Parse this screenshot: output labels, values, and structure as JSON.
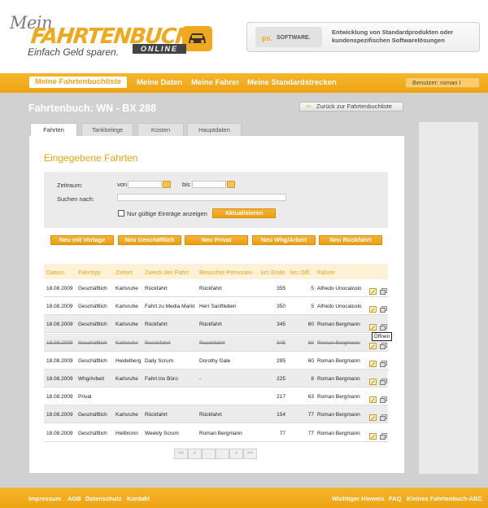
{
  "brand": {
    "mein": "Mein",
    "name": "FAHRTENBUCH",
    "online": "ONLINE",
    "slogan": "Einfach Geld sparen.",
    "accent": "#eea413"
  },
  "partner": {
    "logo_mark": "ps.",
    "logo_text": "SOFTWARE.",
    "text": "Entwicklung von Standardprodukten oder kundenspezifischen Softwarelösungen"
  },
  "nav": {
    "items": [
      "Meine Fahrtenbuchliste",
      "Meine Daten",
      "Meine Fahrer",
      "Meine Standardstrecken"
    ],
    "user": "Benutzer:  roman I"
  },
  "page": {
    "title": "Fahrtenbuch: WN - BX 288",
    "back_label": "Zurück zur Fahrtenbuchliste"
  },
  "tabs": [
    "Fahrten",
    "Tankbelege",
    "Kosten",
    "Hauptdaten"
  ],
  "section_title": "Eingegebene Fahrten",
  "filter": {
    "zeitraum_label": "Zeitraum:",
    "von_label": "von",
    "bis_label": "bis",
    "von_value": "",
    "bis_value": "",
    "suchen_label": "Suchen nach:",
    "suchen_value": "",
    "checkbox_label": "Nur gültige Einträge anzeigen",
    "update_button": "Aktualisieren"
  },
  "actions": [
    "Neu mit Vorlage",
    "Neu Geschäftlich",
    "Neu Privat",
    "Neu Whg/Arbeit",
    "Neu Rückfahrt"
  ],
  "table": {
    "headers": [
      "Datum",
      "Fahrttyp",
      "Zielort",
      "Zweck der Fahrt",
      "Besuchte Personen",
      "km Ende",
      "km Diff.",
      "Fahrer"
    ],
    "rows": [
      [
        "18.08.2009",
        "Geschäftlich",
        "Karlsruhe",
        "Rückfahrt",
        "Rückfahrt",
        "355",
        "5",
        "Alfredo Unocalcolo"
      ],
      [
        "18.08.2009",
        "Geschäftlich",
        "Karlsruhe",
        "Fahrt zu Media Markt",
        "Herr Sanftleben",
        "350",
        "5",
        "Alfredo Unocalcolo"
      ],
      [
        "18.08.2009",
        "Geschäftlich",
        "Karlsruhe",
        "Rückfahrt",
        "Rückfahrt",
        "345",
        "60",
        "Roman Bergmann"
      ],
      [
        "18.08.2009",
        "Geschäftlich",
        "Karlsruhe",
        "Rueckfahrt",
        "Rueckfahrt",
        "345",
        "60",
        "Roman Bergmann"
      ],
      [
        "18.08.2009",
        "Geschäftlich",
        "Heidelberg",
        "Daily Scrum",
        "Dorothy Gale",
        "285",
        "60",
        "Roman Bergmann"
      ],
      [
        "18.08.2009",
        "Whg/Arbeit",
        "Karlsruhe",
        "Fahrt ins Büro",
        "-",
        "225",
        "8",
        "Roman Bergmann"
      ],
      [
        "18.08.2009",
        "Privat",
        "",
        "",
        "",
        "217",
        "63",
        "Roman Bergmann"
      ],
      [
        "18.08.2009",
        "Geschäftlich",
        "Karlsruhe",
        "Rückfahrt",
        "Rückfahrt",
        "154",
        "77",
        "Roman Bergmann"
      ],
      [
        "18.08.2009",
        "Geschäftlich",
        "Heilbronn",
        "Weekly Scrum",
        "Roman Bergmann",
        "77",
        "77",
        "Roman Bergmann"
      ]
    ],
    "tooltip": "Öffnen"
  },
  "pagination": [
    "<<",
    "<",
    "",
    "",
    ">",
    ">>"
  ],
  "footer": {
    "left": [
      "Impressum",
      "AGB",
      "Datenschutz",
      "Kontakt"
    ],
    "right": [
      "Wichtiger Hinweis",
      "FAQ",
      "Kleines Fahrtenbuch-ABC"
    ]
  }
}
